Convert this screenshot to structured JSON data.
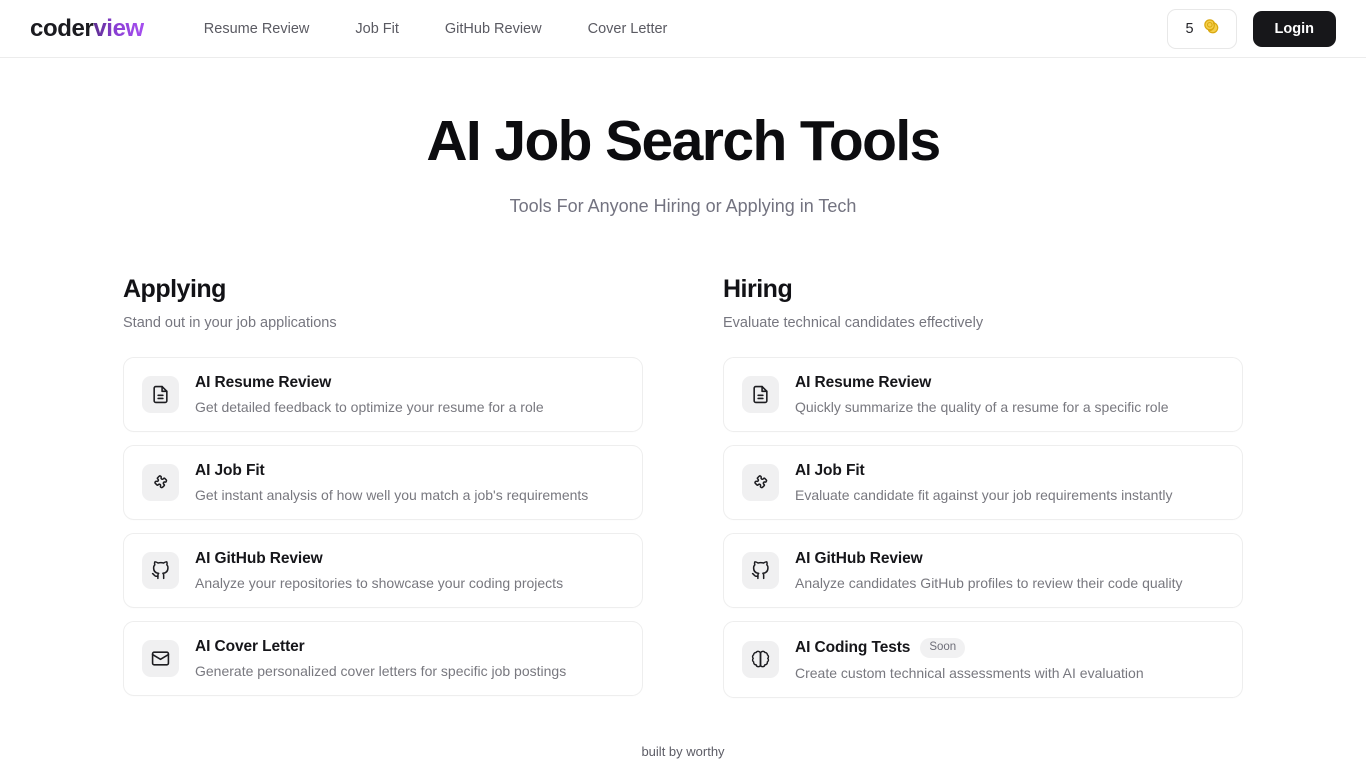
{
  "header": {
    "logo": {
      "part1": "coder",
      "part2": "view"
    },
    "nav": [
      {
        "label": "Resume Review"
      },
      {
        "label": "Job Fit"
      },
      {
        "label": "GitHub Review"
      },
      {
        "label": "Cover Letter"
      }
    ],
    "credits": {
      "count": "5",
      "icon": "coins-icon"
    },
    "login_label": "Login"
  },
  "hero": {
    "title": "AI Job Search Tools",
    "subtitle": "Tools For Anyone Hiring or Applying in Tech"
  },
  "columns": [
    {
      "title": "Applying",
      "subtitle": "Stand out in your job applications",
      "cards": [
        {
          "icon": "document-icon",
          "title": "AI Resume Review",
          "desc": "Get detailed feedback to optimize your resume for a role",
          "badge": ""
        },
        {
          "icon": "puzzle-icon",
          "title": "AI Job Fit",
          "desc": "Get instant analysis of how well you match a job's requirements",
          "badge": ""
        },
        {
          "icon": "github-icon",
          "title": "AI GitHub Review",
          "desc": "Analyze your repositories to showcase your coding projects",
          "badge": ""
        },
        {
          "icon": "mail-icon",
          "title": "AI Cover Letter",
          "desc": "Generate personalized cover letters for specific job postings",
          "badge": ""
        }
      ]
    },
    {
      "title": "Hiring",
      "subtitle": "Evaluate technical candidates effectively",
      "cards": [
        {
          "icon": "document-icon",
          "title": "AI Resume Review",
          "desc": "Quickly summarize the quality of a resume for a specific role",
          "badge": ""
        },
        {
          "icon": "puzzle-icon",
          "title": "AI Job Fit",
          "desc": "Evaluate candidate fit against your job requirements instantly",
          "badge": ""
        },
        {
          "icon": "github-icon",
          "title": "AI GitHub Review",
          "desc": "Analyze candidates GitHub profiles to review their code quality",
          "badge": ""
        },
        {
          "icon": "brain-icon",
          "title": "AI Coding Tests",
          "desc": "Create custom technical assessments with AI evaluation",
          "badge": "Soon"
        }
      ]
    }
  ],
  "footer": {
    "text": "built by worthy"
  },
  "colors": {
    "accent": "#a64ff0",
    "logo_dark": "#1b1b20",
    "login_bg": "#17171a",
    "coin": "#e8b521",
    "icon_bg": "#f0f0f1",
    "card_border": "#eeeeee"
  }
}
